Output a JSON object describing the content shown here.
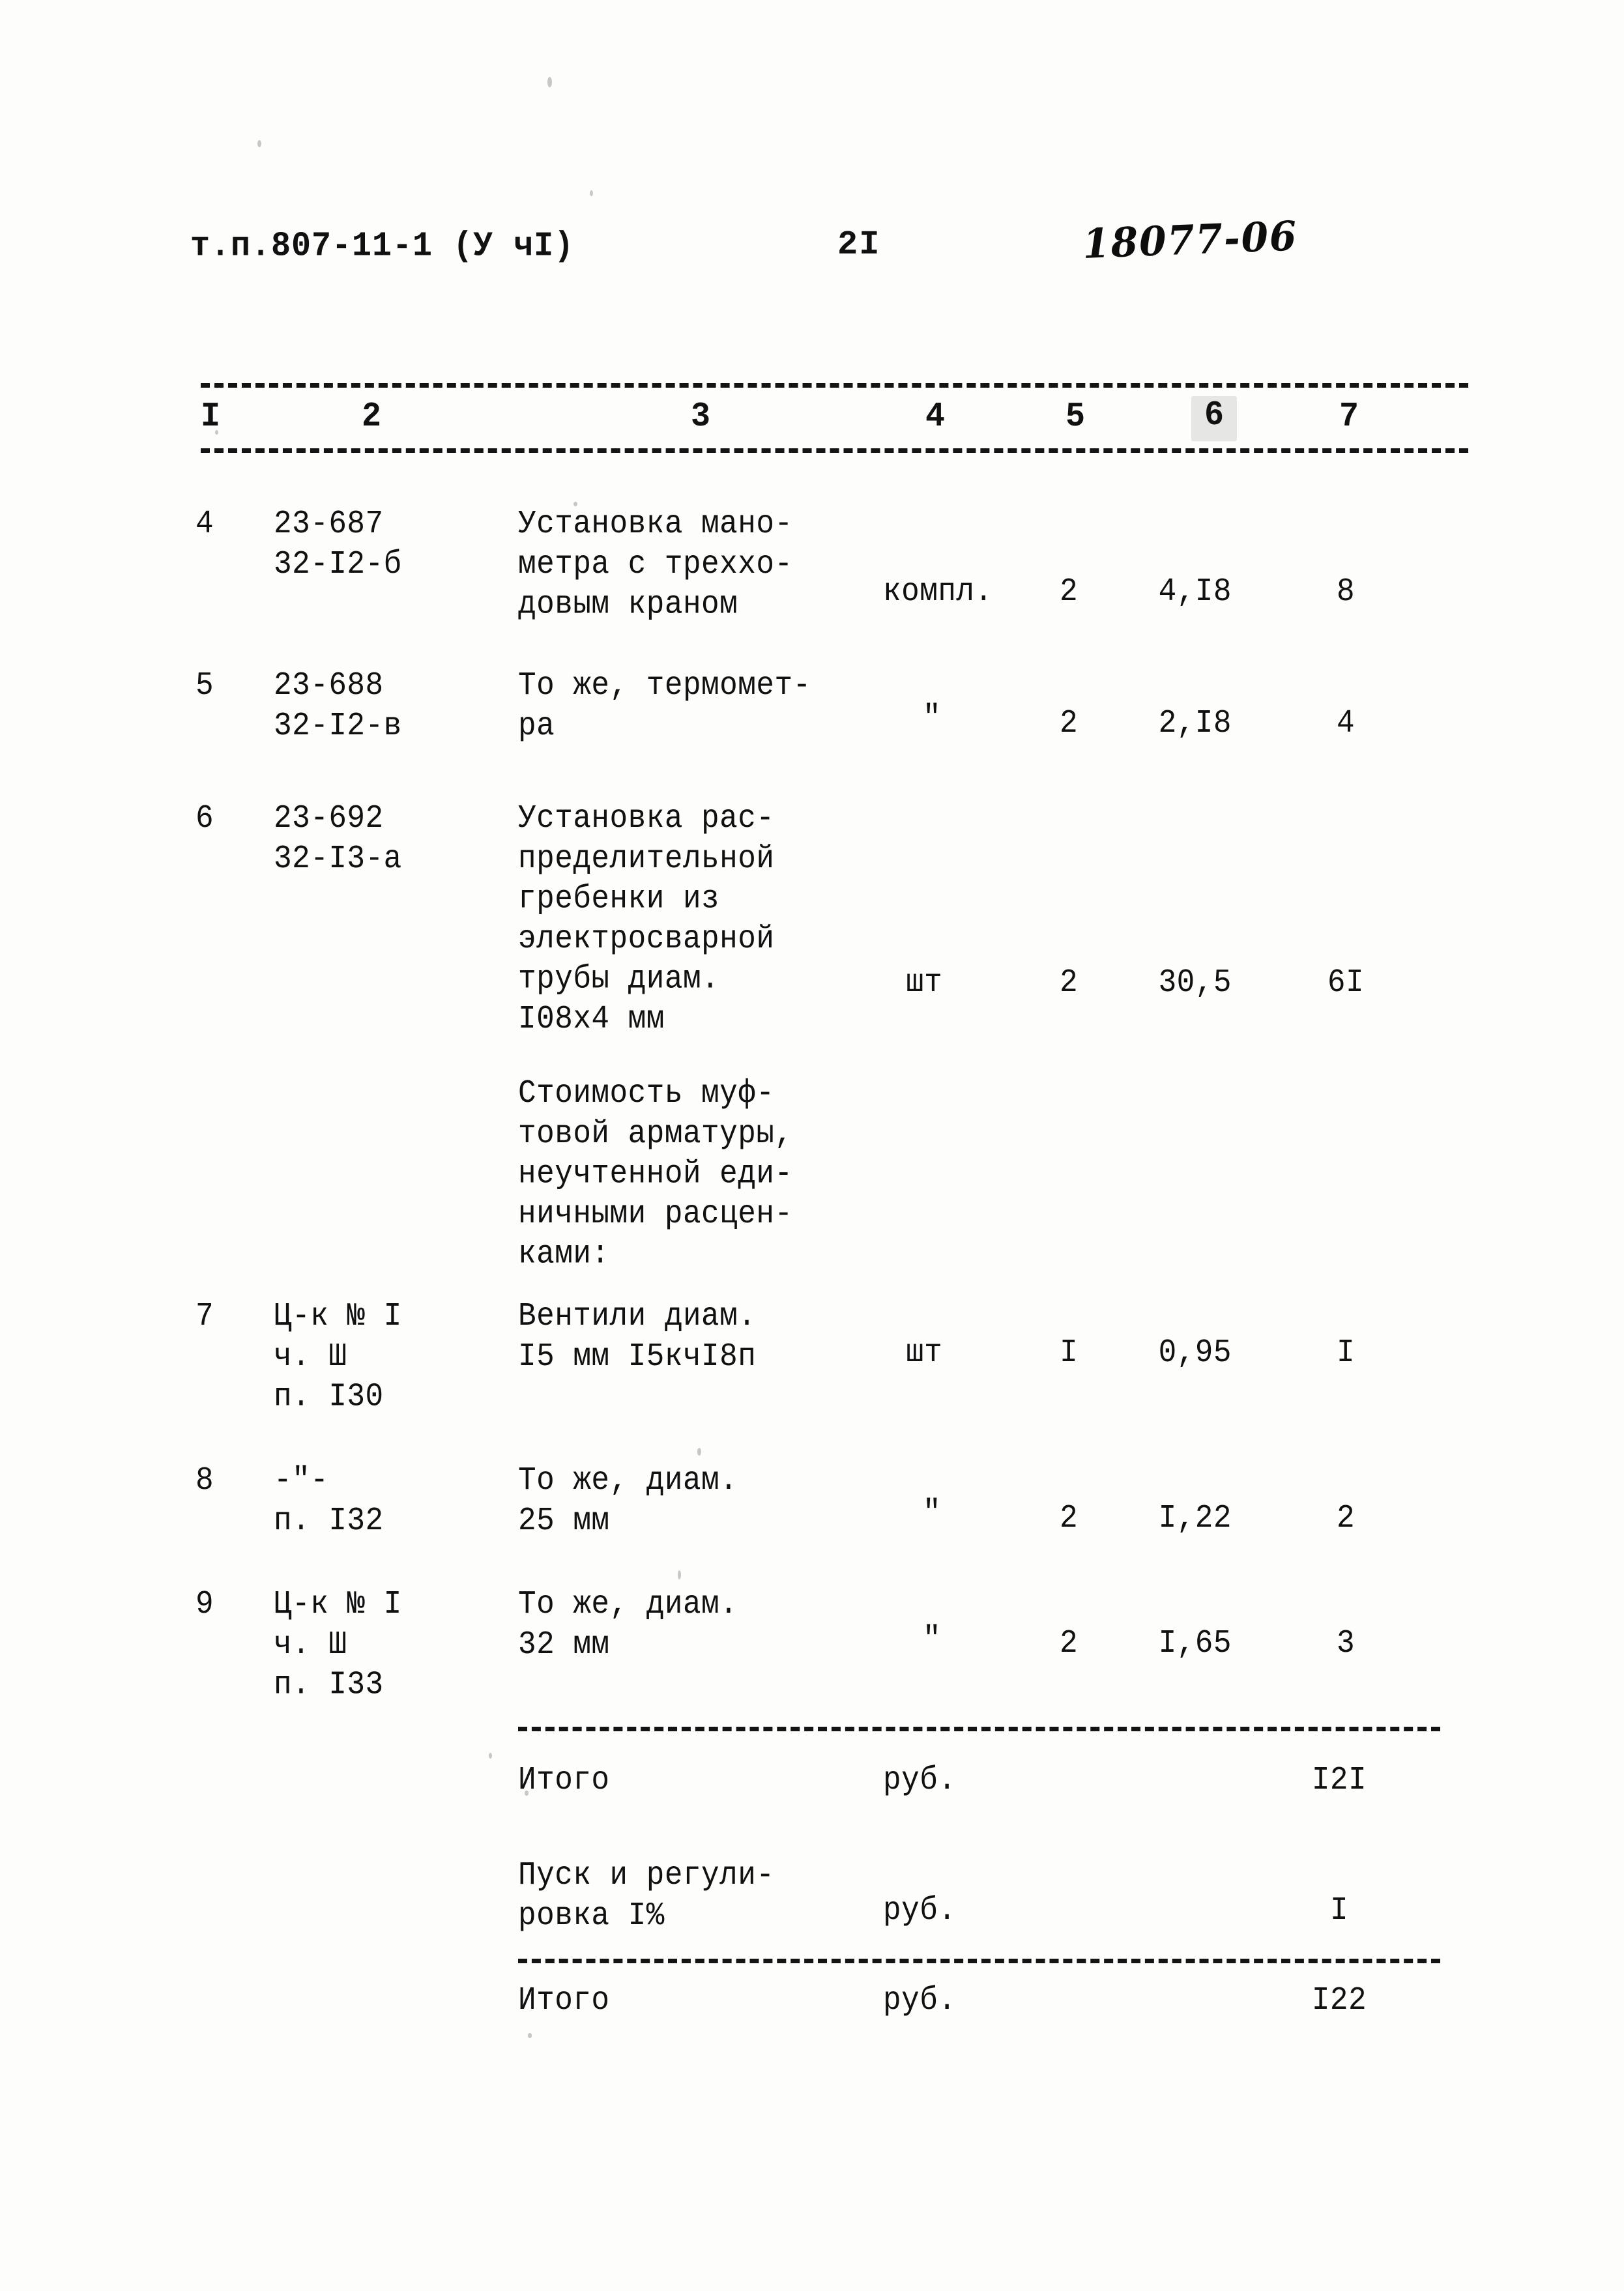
{
  "header": {
    "doc_code": "т.п.807-11-1  (У чI)",
    "page_number": "2I",
    "stamp": "18077-06"
  },
  "table": {
    "column_headers": [
      "I",
      "2",
      "3",
      "4",
      "5",
      "6",
      "7"
    ],
    "highlighted_column": "6",
    "rows": [
      {
        "no": "4",
        "code": "23-687\n32-I2-б",
        "description": "Установка мано-\nметра с треххо-\nдовым краном",
        "unit": "компл.",
        "qty": "2",
        "price": "4,I8",
        "total": "8"
      },
      {
        "no": "5",
        "code": "23-688\n32-I2-в",
        "description": "То же, термомет-\nра",
        "unit": "\"",
        "qty": "2",
        "price": "2,I8",
        "total": "4"
      },
      {
        "no": "6",
        "code": "23-692\n32-I3-а",
        "description": "Установка рас-\nпределительной\nгребенки из\nэлектросварной\nтрубы диам.\nI08x4 мм",
        "unit": "шт",
        "qty": "2",
        "price": "30,5",
        "total": "6I"
      },
      {
        "no": "7",
        "code": "Ц-к № I\nч. Ш\nп. I30",
        "description": "Вентили диам.\nI5 мм I5кчI8п",
        "unit": "шт",
        "qty": "I",
        "price": "0,95",
        "total": "I"
      },
      {
        "no": "8",
        "code": "-\"-\nп. I32",
        "description": "То же, диам.\n25 мм",
        "unit": "\"",
        "qty": "2",
        "price": "I,22",
        "total": "2"
      },
      {
        "no": "9",
        "code": "Ц-к № I\nч. Ш\nп. I33",
        "description": "То же, диам.\n32 мм",
        "unit": "\"",
        "qty": "2",
        "price": "I,65",
        "total": "3"
      }
    ],
    "note_block": "Стоимость муф-\nтовой арматуры,\nнеучтенной еди-\nничными расцен-\nками:",
    "summary": [
      {
        "label": "Итого",
        "unit": "руб.",
        "total": "I2I"
      },
      {
        "label": "Пуск и регули-\nровка I%",
        "unit": "руб.",
        "total": "I"
      },
      {
        "label": "Итого",
        "unit": "руб.",
        "total": "I22"
      }
    ]
  }
}
